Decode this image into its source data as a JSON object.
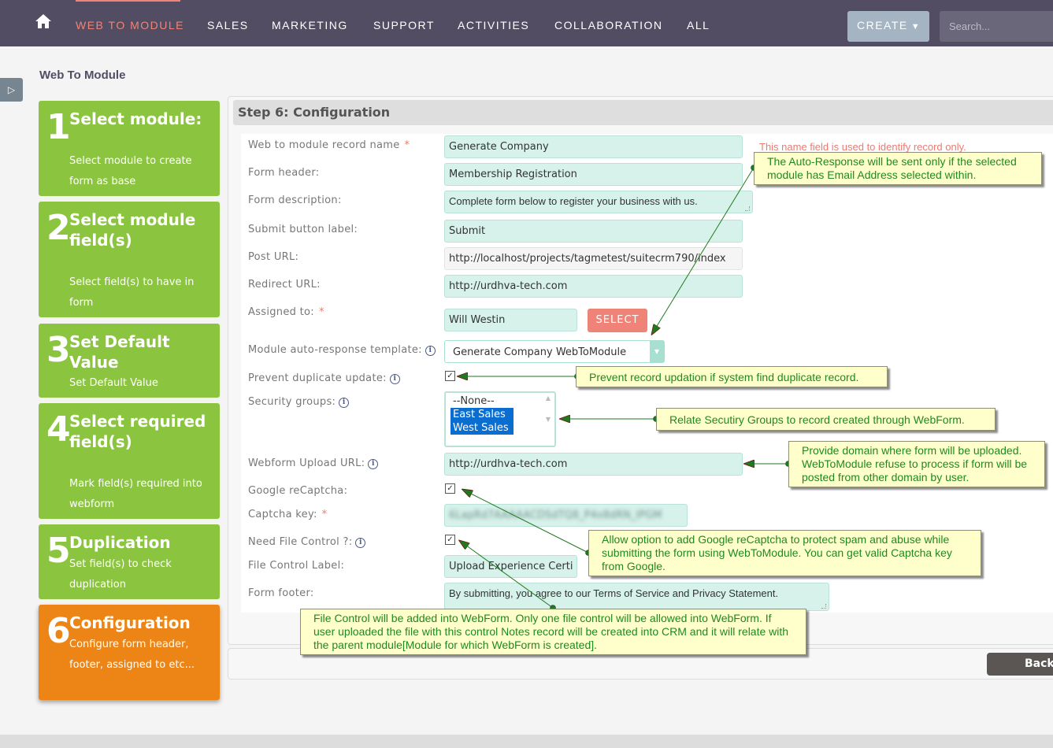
{
  "nav": {
    "items": [
      "WEB TO MODULE",
      "SALES",
      "MARKETING",
      "SUPPORT",
      "ACTIVITIES",
      "COLLABORATION",
      "ALL"
    ],
    "active": "WEB TO MODULE",
    "create_label": "CREATE",
    "search_placeholder": "Search..."
  },
  "page_title": "Web To Module",
  "steps": [
    {
      "num": "1",
      "title": "Select module:",
      "desc": "Select module to create form as base",
      "state": "done"
    },
    {
      "num": "2",
      "title": "Select module field(s)",
      "desc": "Select field(s) to have in form",
      "state": "done"
    },
    {
      "num": "3",
      "title": "Set Default Value",
      "desc": "Set Default Value",
      "state": "done"
    },
    {
      "num": "4",
      "title": "Select required field(s)",
      "desc": "Mark field(s) required into webform",
      "state": "done"
    },
    {
      "num": "5",
      "title": "Duplication",
      "desc": "Set field(s) to check duplication",
      "state": "done"
    },
    {
      "num": "6",
      "title": "Configuration",
      "desc": "Configure form header, footer, assigned to etc...",
      "state": "current"
    }
  ],
  "panel_title": "Step 6: Configuration",
  "form": {
    "record_name": {
      "label": "Web to module record name",
      "value": "Generate Company",
      "hint": "This name field is used to identify record only."
    },
    "form_header": {
      "label": "Form header:",
      "value": "Membership Registration"
    },
    "form_description": {
      "label": "Form description:",
      "value": "Complete form below to register your business with us."
    },
    "submit_label": {
      "label": "Submit button label:",
      "value": "Submit"
    },
    "post_url": {
      "label": "Post URL:",
      "value": "http://localhost/projects/tagmetest/suitecrm790/index"
    },
    "redirect_url": {
      "label": "Redirect URL:",
      "value": "http://urdhva-tech.com"
    },
    "assigned_to": {
      "label": "Assigned to:",
      "value": "Will Westin",
      "button": "SELECT"
    },
    "auto_response": {
      "label": "Module auto-response template:",
      "value": "Generate Company WebToModule"
    },
    "prevent_duplicate": {
      "label": "Prevent duplicate update:",
      "checked": true
    },
    "security_groups": {
      "label": "Security groups:",
      "options": [
        "--None--",
        "East Sales",
        "West Sales"
      ],
      "selected": [
        "East Sales",
        "West Sales"
      ]
    },
    "upload_url": {
      "label": "Webform Upload URL:",
      "value": "http://urdhva-tech.com"
    },
    "recaptcha": {
      "label": "Google reCaptcha:",
      "checked": true
    },
    "captcha_key": {
      "label": "Captcha key:",
      "value": "6LapRd7AAAAACDSdTQ8_P4o8dRN_IPGM"
    },
    "file_control": {
      "label": "Need File Control ?:",
      "checked": true
    },
    "file_control_label": {
      "label": "File Control Label:",
      "value": "Upload Experience Certi"
    },
    "form_footer": {
      "label": "Form footer:",
      "value": "By submitting, you agree to our Terms of Service and Privacy Statement."
    }
  },
  "back_label": "Back",
  "callouts": {
    "auto_response": "The Auto-Response will be sent only if the selected module has Email Address selected within.",
    "prevent_duplicate": "Prevent record updation if system find duplicate record.",
    "security_groups": "Relate Secutiry Groups to record created through WebForm.",
    "upload_url": "Provide domain where form will be uploaded. WebToModule refuse to process if form will be posted from other domain by user.",
    "recaptcha": "Allow option to add Google reCaptcha to protect spam and abuse while submitting the form using WebToModule. You can get valid Captcha key from Google.",
    "file_control": "File Control will be added into WebForm. Only one file control will be allowed into WebForm. If user uploaded the file with this control Notes record will be created into CRM and it will relate with the parent module[Module for which WebForm is created]."
  }
}
